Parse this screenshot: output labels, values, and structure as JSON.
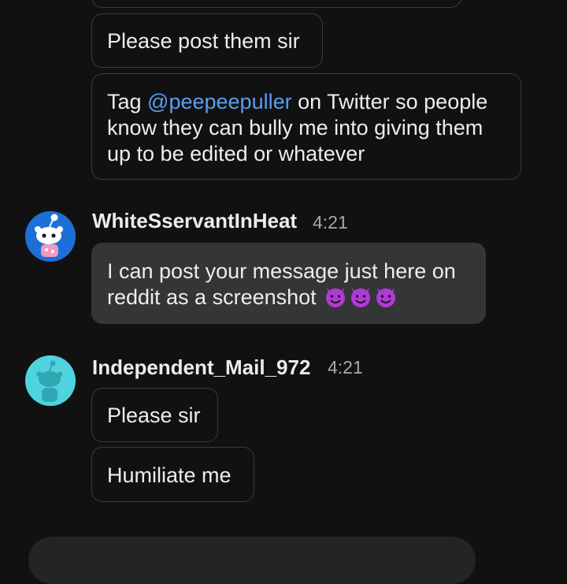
{
  "messages": [
    {
      "text": "Please post them sir"
    },
    {
      "pre": "Tag ",
      "mention": "@peepeepuller",
      "post": " on Twitter so people know they can bully me into giving them up to be edited or whatever"
    },
    {
      "author": "WhiteSservantInHeat",
      "time": "4:21",
      "text": "I can post your message just here on reddit as a screenshot ",
      "emoji": [
        "smiling-devil",
        "smiling-devil",
        "smiling-devil"
      ]
    },
    {
      "author": "Independent_Mail_972",
      "time": "4:21",
      "texts": [
        "Please sir",
        "Humiliate me"
      ]
    }
  ],
  "colors": {
    "background": "#111112",
    "mention": "#5b9df0",
    "bubble_border": "#3a3b3d",
    "bubble_filled": "#343537",
    "emoji": "#b03bd4"
  },
  "avatars": {
    "white": "snoo-avatar-blue",
    "independent": "snoo-avatar-cyan"
  }
}
